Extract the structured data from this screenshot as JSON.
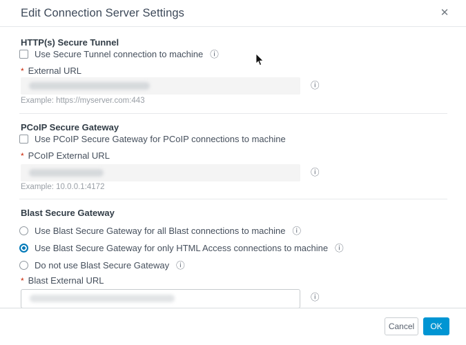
{
  "dialog": {
    "title": "Edit Connection Server Settings"
  },
  "icons": {
    "close": "✕",
    "info": "ⓘ"
  },
  "sections": {
    "tunnel": {
      "heading": "HTTP(s) Secure Tunnel",
      "checkbox_label": "Use Secure Tunnel connection to machine",
      "checkbox_checked": false,
      "required_marker": "*",
      "field_label": "External URL",
      "field_value_state": "redacted",
      "example": "Example: https://myserver.com:443"
    },
    "pcoip": {
      "heading": "PCoIP Secure Gateway",
      "checkbox_label": "Use PCoIP Secure Gateway for PCoIP connections to machine",
      "checkbox_checked": false,
      "required_marker": "*",
      "field_label": "PCoIP External URL",
      "field_value_state": "redacted",
      "example": "Example: 10.0.0.1:4172"
    },
    "blast": {
      "heading": "Blast Secure Gateway",
      "options": [
        {
          "label": "Use Blast Secure Gateway for all Blast connections to machine",
          "selected": false,
          "has_info": true
        },
        {
          "label": "Use Blast Secure Gateway for only HTML Access connections to machine",
          "selected": true,
          "has_info": true
        },
        {
          "label": "Do not use Blast Secure Gateway",
          "selected": false,
          "has_info": true
        }
      ],
      "required_marker": "*",
      "field_label": "Blast External URL",
      "field_value_state": "redacted"
    }
  },
  "footer": {
    "cancel_label": "Cancel",
    "ok_label": "OK"
  },
  "colors": {
    "accent_blue": "#0095d3",
    "radio_selected_blue": "#0079b8",
    "required_red": "#c92100"
  }
}
